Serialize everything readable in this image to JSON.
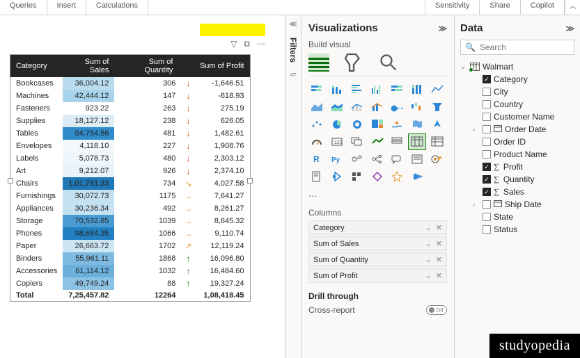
{
  "ribbon": {
    "queries": "Queries",
    "insert": "Insert",
    "calculations": "Calculations",
    "sensitivity": "Sensitivity",
    "share": "Share",
    "copilot": "Copilot"
  },
  "filters_label": "Filters",
  "viz_pane": {
    "title": "Visualizations",
    "build": "Build visual",
    "columns_label": "Columns",
    "drill": "Drill through",
    "cross": "Cross-report",
    "toggle_off": "Off"
  },
  "wells": [
    {
      "name": "Category"
    },
    {
      "name": "Sum of Sales"
    },
    {
      "name": "Sum of Quantity"
    },
    {
      "name": "Sum of Profit"
    }
  ],
  "data_pane": {
    "title": "Data",
    "search_placeholder": "Search",
    "table_name": "Walmart"
  },
  "fields": [
    {
      "name": "Category",
      "checked": true,
      "sigma": false,
      "date": false
    },
    {
      "name": "City",
      "checked": false,
      "sigma": false,
      "date": false
    },
    {
      "name": "Country",
      "checked": false,
      "sigma": false,
      "date": false
    },
    {
      "name": "Customer Name",
      "checked": false,
      "sigma": false,
      "date": false
    },
    {
      "name": "Order Date",
      "checked": false,
      "sigma": false,
      "date": true
    },
    {
      "name": "Order ID",
      "checked": false,
      "sigma": false,
      "date": false
    },
    {
      "name": "Product Name",
      "checked": false,
      "sigma": false,
      "date": false
    },
    {
      "name": "Profit",
      "checked": true,
      "sigma": true,
      "date": false
    },
    {
      "name": "Quantity",
      "checked": true,
      "sigma": true,
      "date": false
    },
    {
      "name": "Sales",
      "checked": true,
      "sigma": true,
      "date": false
    },
    {
      "name": "Ship Date",
      "checked": false,
      "sigma": false,
      "date": true
    },
    {
      "name": "State",
      "checked": false,
      "sigma": false,
      "date": false
    },
    {
      "name": "Status",
      "checked": false,
      "sigma": false,
      "date": false
    }
  ],
  "headers": {
    "cat": "Category",
    "sales": "Sum of Sales",
    "qty": "Sum of Quantity",
    "profit": "Sum of Profit"
  },
  "rows": [
    {
      "cat": "Bookcases",
      "sales": "36,004.12",
      "shade": "#badcef",
      "qty": "306",
      "dir": "down",
      "profit": "-1,646.51"
    },
    {
      "cat": "Machines",
      "sales": "42,444.12",
      "shade": "#a8d3ec",
      "qty": "147",
      "dir": "down",
      "profit": "-618.93"
    },
    {
      "cat": "Fasteners",
      "sales": "923.22",
      "shade": "#ffffff",
      "qty": "263",
      "dir": "down",
      "profit": "275.19"
    },
    {
      "cat": "Supplies",
      "sales": "18,127.12",
      "shade": "#dbecf6",
      "qty": "238",
      "dir": "down",
      "profit": "626.05"
    },
    {
      "cat": "Tables",
      "sales": "84,754.56",
      "shade": "#2f8bc9",
      "qty": "481",
      "dir": "down",
      "profit": "1,482.61"
    },
    {
      "cat": "Envelopes",
      "sales": "4,118.10",
      "shade": "#f2f8fc",
      "qty": "227",
      "dir": "down",
      "profit": "1,908.76"
    },
    {
      "cat": "Labels",
      "sales": "5,078.73",
      "shade": "#eef6fb",
      "qty": "480",
      "dir": "down",
      "profit": "2,303.12"
    },
    {
      "cat": "Art",
      "sales": "9,212.07",
      "shade": "#e7f2f9",
      "qty": "926",
      "dir": "down",
      "profit": "2,374.10"
    },
    {
      "cat": "Chairs",
      "sales": "1,01,781.33",
      "shade": "#1f77b4",
      "qty": "734",
      "dir": "diag",
      "profit": "4,027.58"
    },
    {
      "cat": "Furnishings",
      "sales": "30,072.73",
      "shade": "#c4e1f2",
      "qty": "1175",
      "dir": "right",
      "profit": "7,641.27"
    },
    {
      "cat": "Appliances",
      "sales": "30,236.34",
      "shade": "#c4e1f2",
      "qty": "492",
      "dir": "right",
      "profit": "8,261.27"
    },
    {
      "cat": "Storage",
      "sales": "70,532.85",
      "shade": "#4a9bd1",
      "qty": "1039",
      "dir": "right",
      "profit": "8,645.32"
    },
    {
      "cat": "Phones",
      "sales": "98,684.35",
      "shade": "#2280c2",
      "qty": "1066",
      "dir": "right",
      "profit": "9,110.74"
    },
    {
      "cat": "Paper",
      "sales": "26,663.72",
      "shade": "#cce5f3",
      "qty": "1702",
      "dir": "upd",
      "profit": "12,119.24"
    },
    {
      "cat": "Binders",
      "sales": "55,961.11",
      "shade": "#7db9e0",
      "qty": "1868",
      "dir": "up",
      "profit": "16,096.80"
    },
    {
      "cat": "Accessories",
      "sales": "61,114.12",
      "shade": "#6bafdb",
      "qty": "1032",
      "dir": "up",
      "profit": "16,484.60"
    },
    {
      "cat": "Copiers",
      "sales": "49,749.24",
      "shade": "#8cc2e4",
      "qty": "88",
      "dir": "up",
      "profit": "19,327.24"
    }
  ],
  "total": {
    "cat": "Total",
    "sales": "7,25,457.82",
    "qty": "12264",
    "profit": "1,08,418.45"
  },
  "watermark": "studyopedia",
  "chart_data": {
    "type": "table",
    "title": "Sales / Quantity / Profit by Category",
    "columns": [
      "Category",
      "Sum of Sales",
      "Sum of Quantity",
      "Sum of Profit"
    ],
    "rows": [
      [
        "Bookcases",
        36004.12,
        306,
        -1646.51
      ],
      [
        "Machines",
        42444.12,
        147,
        -618.93
      ],
      [
        "Fasteners",
        923.22,
        263,
        275.19
      ],
      [
        "Supplies",
        18127.12,
        238,
        626.05
      ],
      [
        "Tables",
        84754.56,
        481,
        1482.61
      ],
      [
        "Envelopes",
        4118.1,
        227,
        1908.76
      ],
      [
        "Labels",
        5078.73,
        480,
        2303.12
      ],
      [
        "Art",
        9212.07,
        926,
        2374.1
      ],
      [
        "Chairs",
        101781.33,
        734,
        4027.58
      ],
      [
        "Furnishings",
        30072.73,
        1175,
        7641.27
      ],
      [
        "Appliances",
        30236.34,
        492,
        8261.27
      ],
      [
        "Storage",
        70532.85,
        1039,
        8645.32
      ],
      [
        "Phones",
        98684.35,
        1066,
        9110.74
      ],
      [
        "Paper",
        26663.72,
        1702,
        12119.24
      ],
      [
        "Binders",
        55961.11,
        1868,
        16096.8
      ],
      [
        "Accessories",
        61114.12,
        1032,
        16484.6
      ],
      [
        "Copiers",
        49749.24,
        88,
        19327.24
      ]
    ],
    "totals": [
      "Total",
      725457.82,
      12264,
      108418.45
    ]
  }
}
